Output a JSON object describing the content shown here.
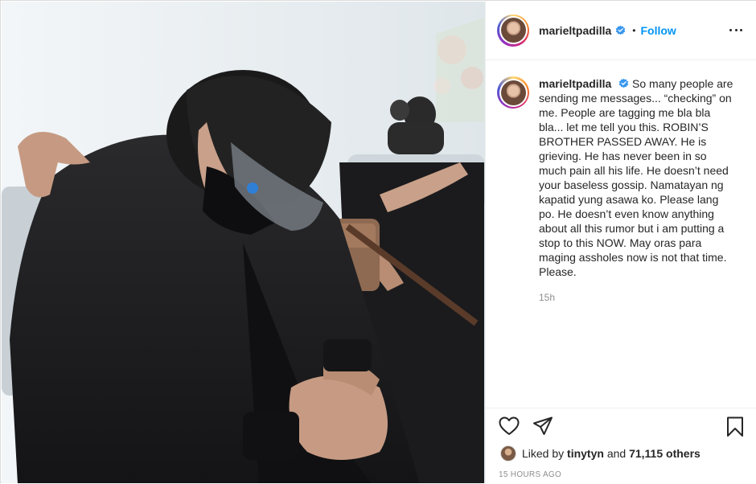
{
  "post": {
    "username": "marieltpadilla",
    "follow_label": "Follow",
    "separator": "•",
    "caption": "So many people are sending me messages... “checking” on me. People are tagging me bla bla bla... let me tell you this. ROBIN’S BROTHER PASSED AWAY. He is grieving. He has never been in so much pain all his life. He doesn’t need your baseless gossip. Namatayan ng kapatid yung asawa ko. Please lang po. He doesn’t even know anything about all this rumor but i am putting a stop to this NOW. May oras para maging assholes now is not that time. Please.",
    "caption_age": "15h",
    "liked_by_prefix": "Liked by",
    "liked_by_user": "tinytyn",
    "liked_by_and": "and",
    "liked_by_others": "71,115 others",
    "timestamp": "15 HOURS AGO"
  },
  "icons": {
    "verified": "verified-badge-icon",
    "more": "more-options-icon",
    "like": "heart-icon",
    "share": "paper-plane-icon",
    "save": "bookmark-icon"
  },
  "colors": {
    "accent": "#0095f6",
    "text": "#262626",
    "muted": "#8e8e8e",
    "border": "#efefef"
  }
}
